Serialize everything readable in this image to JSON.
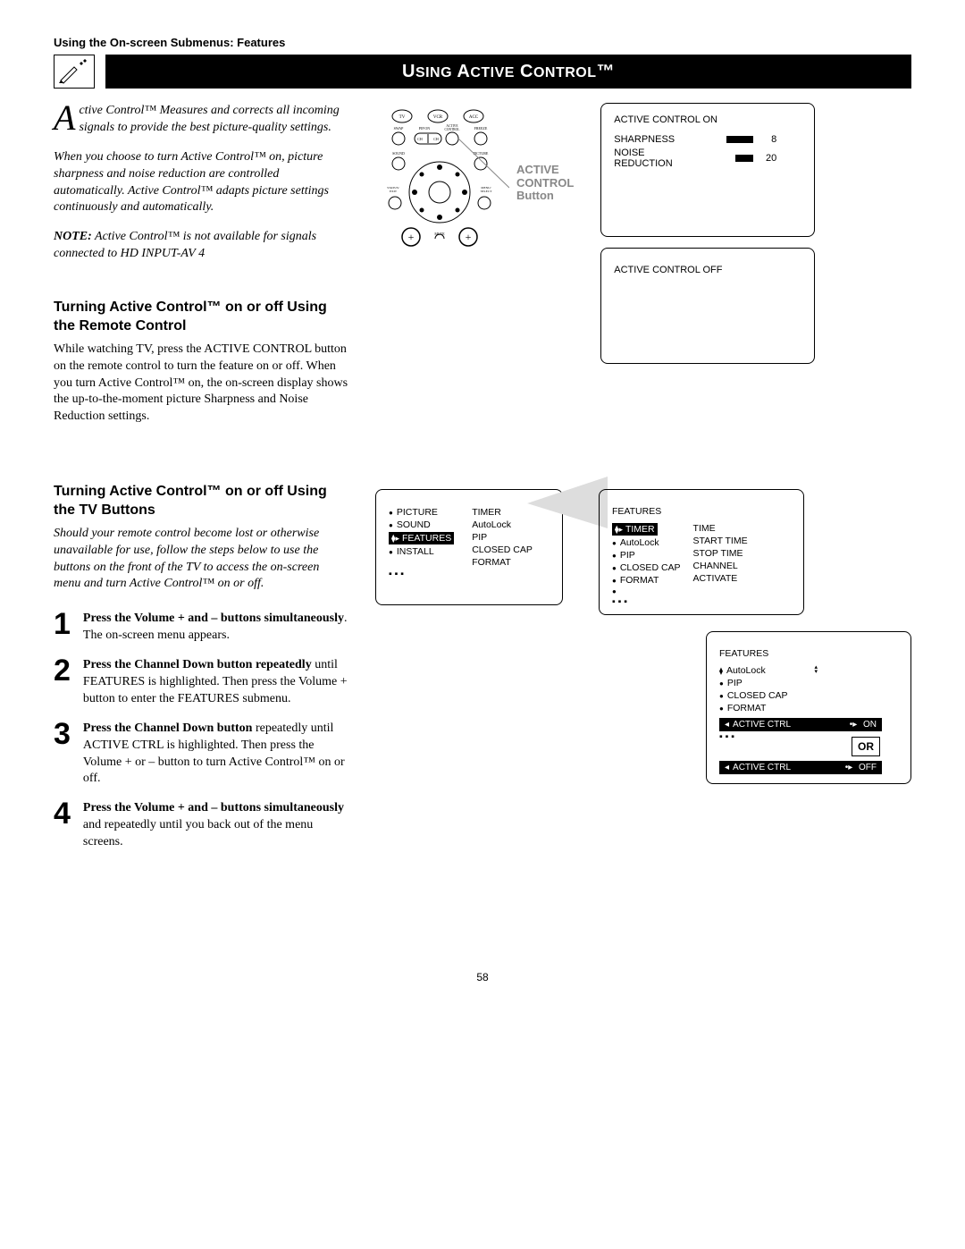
{
  "breadcrumb": "Using the On-screen Submenus: Features",
  "title": "USING ACTIVE CONTROL™",
  "intro_p1": "ctive Control™ Measures and corrects all incoming signals to provide the best picture-quality settings.",
  "intro_p2": "When you choose to turn Active Control™ on, picture sharpness and noise reduction are controlled automatically. Active Control™ adapts picture settings continuously and automatically.",
  "note_label": "NOTE:",
  "note_text": " Active Control™ is not available for signals connected to HD INPUT-AV 4",
  "h2_remote": "Turning Active Control™ on or off Using the Remote Control",
  "remote_body": "While watching TV, press the ACTIVE CONTROL button on the remote control to turn the feature on or off. When you turn Active Control™ on, the on-screen display shows the up-to-the-moment picture Sharpness and Noise Reduction settings.",
  "h2_tv": "Turning Active Control™ on or off Using the TV Buttons",
  "tv_intro": "Should your remote control become lost or otherwise unavailable for use, follow the steps below to use the buttons on the front of the TV to access the on-screen menu and turn Active Control™ on or off.",
  "steps": [
    {
      "n": "1",
      "bold": "Press the Volume + and – buttons simultaneously",
      "rest": ". The on-screen menu appears."
    },
    {
      "n": "2",
      "bold": "Press the Channel Down button repeatedly",
      "rest": " until FEATURES is highlighted. Then press the Volume + button to enter the FEATURES submenu."
    },
    {
      "n": "3",
      "bold": "Press the Channel Down button",
      "rest": " repeatedly until ACTIVE CTRL is highlighted. Then press the Volume + or – button to turn Active Control™ on or off."
    },
    {
      "n": "4",
      "bold": "Press the Volume + and – buttons simultaneously",
      "rest": " and repeatedly until you back out of the menu screens."
    }
  ],
  "osd_on": {
    "title": "ACTIVE CONTROL   ON",
    "rows": [
      {
        "label": "SHARPNESS",
        "val": "8",
        "fill": 40
      },
      {
        "label": "NOISE REDUCTION",
        "val": "20",
        "fill": 60
      }
    ]
  },
  "osd_off": {
    "title": "ACTIVE CONTROL   OFF"
  },
  "callout": {
    "l1": "ACTIVE",
    "l2": "CONTROL",
    "l3": "Button"
  },
  "remote_labels": {
    "tv": "TV",
    "vcr": "VCR",
    "acc": "ACC",
    "swap": "SWAP",
    "pipon": "PIP ON",
    "active": "ACTIVE CONTROL",
    "freeze": "FREEZE",
    "ch_dn": "CH",
    "ch_up": "CH",
    "sound": "SOUND",
    "picture": "PICTURE",
    "status": "STATUS/ EXIT",
    "menu": "MENU/ SELECT",
    "mute": "MUTE"
  },
  "menu_main": {
    "left": [
      "PICTURE",
      "SOUND",
      "FEATURES",
      "INSTALL"
    ],
    "left_sel_index": 2,
    "right": [
      "TIMER",
      "AutoLock",
      "PIP",
      "CLOSED CAP",
      "FORMAT"
    ]
  },
  "menu_feat_top": {
    "title": "FEATURES",
    "rows": [
      {
        "l": "TIMER",
        "sel": true,
        "r": "TIME"
      },
      {
        "l": "AutoLock",
        "r": "START TIME"
      },
      {
        "l": "PIP",
        "r": "STOP TIME"
      },
      {
        "l": "CLOSED CAP",
        "r": "CHANNEL"
      },
      {
        "l": "FORMAT",
        "r": "ACTIVATE"
      },
      {
        "l": "",
        "r": ""
      }
    ]
  },
  "menu_feat_bottom": {
    "title": "FEATURES",
    "rows": [
      "AutoLock",
      "PIP",
      "CLOSED CAP",
      "FORMAT"
    ],
    "active_label": "ACTIVE CTRL",
    "on": "ON",
    "off": "OFF",
    "or": "OR"
  },
  "page": "58"
}
